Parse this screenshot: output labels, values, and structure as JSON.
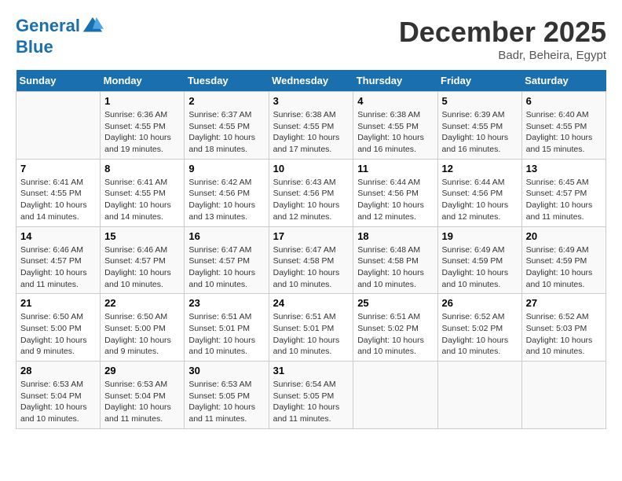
{
  "header": {
    "logo_line1": "General",
    "logo_line2": "Blue",
    "month": "December 2025",
    "location": "Badr, Beheira, Egypt"
  },
  "weekdays": [
    "Sunday",
    "Monday",
    "Tuesday",
    "Wednesday",
    "Thursday",
    "Friday",
    "Saturday"
  ],
  "weeks": [
    [
      {
        "day": "",
        "info": ""
      },
      {
        "day": "1",
        "info": "Sunrise: 6:36 AM\nSunset: 4:55 PM\nDaylight: 10 hours\nand 19 minutes."
      },
      {
        "day": "2",
        "info": "Sunrise: 6:37 AM\nSunset: 4:55 PM\nDaylight: 10 hours\nand 18 minutes."
      },
      {
        "day": "3",
        "info": "Sunrise: 6:38 AM\nSunset: 4:55 PM\nDaylight: 10 hours\nand 17 minutes."
      },
      {
        "day": "4",
        "info": "Sunrise: 6:38 AM\nSunset: 4:55 PM\nDaylight: 10 hours\nand 16 minutes."
      },
      {
        "day": "5",
        "info": "Sunrise: 6:39 AM\nSunset: 4:55 PM\nDaylight: 10 hours\nand 16 minutes."
      },
      {
        "day": "6",
        "info": "Sunrise: 6:40 AM\nSunset: 4:55 PM\nDaylight: 10 hours\nand 15 minutes."
      }
    ],
    [
      {
        "day": "7",
        "info": "Sunrise: 6:41 AM\nSunset: 4:55 PM\nDaylight: 10 hours\nand 14 minutes."
      },
      {
        "day": "8",
        "info": "Sunrise: 6:41 AM\nSunset: 4:55 PM\nDaylight: 10 hours\nand 14 minutes."
      },
      {
        "day": "9",
        "info": "Sunrise: 6:42 AM\nSunset: 4:56 PM\nDaylight: 10 hours\nand 13 minutes."
      },
      {
        "day": "10",
        "info": "Sunrise: 6:43 AM\nSunset: 4:56 PM\nDaylight: 10 hours\nand 12 minutes."
      },
      {
        "day": "11",
        "info": "Sunrise: 6:44 AM\nSunset: 4:56 PM\nDaylight: 10 hours\nand 12 minutes."
      },
      {
        "day": "12",
        "info": "Sunrise: 6:44 AM\nSunset: 4:56 PM\nDaylight: 10 hours\nand 12 minutes."
      },
      {
        "day": "13",
        "info": "Sunrise: 6:45 AM\nSunset: 4:57 PM\nDaylight: 10 hours\nand 11 minutes."
      }
    ],
    [
      {
        "day": "14",
        "info": "Sunrise: 6:46 AM\nSunset: 4:57 PM\nDaylight: 10 hours\nand 11 minutes."
      },
      {
        "day": "15",
        "info": "Sunrise: 6:46 AM\nSunset: 4:57 PM\nDaylight: 10 hours\nand 10 minutes."
      },
      {
        "day": "16",
        "info": "Sunrise: 6:47 AM\nSunset: 4:57 PM\nDaylight: 10 hours\nand 10 minutes."
      },
      {
        "day": "17",
        "info": "Sunrise: 6:47 AM\nSunset: 4:58 PM\nDaylight: 10 hours\nand 10 minutes."
      },
      {
        "day": "18",
        "info": "Sunrise: 6:48 AM\nSunset: 4:58 PM\nDaylight: 10 hours\nand 10 minutes."
      },
      {
        "day": "19",
        "info": "Sunrise: 6:49 AM\nSunset: 4:59 PM\nDaylight: 10 hours\nand 10 minutes."
      },
      {
        "day": "20",
        "info": "Sunrise: 6:49 AM\nSunset: 4:59 PM\nDaylight: 10 hours\nand 10 minutes."
      }
    ],
    [
      {
        "day": "21",
        "info": "Sunrise: 6:50 AM\nSunset: 5:00 PM\nDaylight: 10 hours\nand 9 minutes."
      },
      {
        "day": "22",
        "info": "Sunrise: 6:50 AM\nSunset: 5:00 PM\nDaylight: 10 hours\nand 9 minutes."
      },
      {
        "day": "23",
        "info": "Sunrise: 6:51 AM\nSunset: 5:01 PM\nDaylight: 10 hours\nand 10 minutes."
      },
      {
        "day": "24",
        "info": "Sunrise: 6:51 AM\nSunset: 5:01 PM\nDaylight: 10 hours\nand 10 minutes."
      },
      {
        "day": "25",
        "info": "Sunrise: 6:51 AM\nSunset: 5:02 PM\nDaylight: 10 hours\nand 10 minutes."
      },
      {
        "day": "26",
        "info": "Sunrise: 6:52 AM\nSunset: 5:02 PM\nDaylight: 10 hours\nand 10 minutes."
      },
      {
        "day": "27",
        "info": "Sunrise: 6:52 AM\nSunset: 5:03 PM\nDaylight: 10 hours\nand 10 minutes."
      }
    ],
    [
      {
        "day": "28",
        "info": "Sunrise: 6:53 AM\nSunset: 5:04 PM\nDaylight: 10 hours\nand 10 minutes."
      },
      {
        "day": "29",
        "info": "Sunrise: 6:53 AM\nSunset: 5:04 PM\nDaylight: 10 hours\nand 11 minutes."
      },
      {
        "day": "30",
        "info": "Sunrise: 6:53 AM\nSunset: 5:05 PM\nDaylight: 10 hours\nand 11 minutes."
      },
      {
        "day": "31",
        "info": "Sunrise: 6:54 AM\nSunset: 5:05 PM\nDaylight: 10 hours\nand 11 minutes."
      },
      {
        "day": "",
        "info": ""
      },
      {
        "day": "",
        "info": ""
      },
      {
        "day": "",
        "info": ""
      }
    ]
  ]
}
